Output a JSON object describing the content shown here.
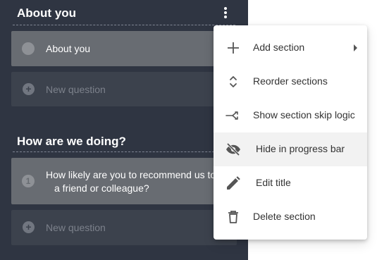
{
  "sections": [
    {
      "title": "About you",
      "items": [
        {
          "label": "About you",
          "number": ""
        }
      ],
      "new_question_label": "New question"
    },
    {
      "title": "How are we doing?",
      "items": [
        {
          "label_line1": "How likely are you to recommend us to",
          "label_line2": "a friend or colleague?",
          "number": "1"
        }
      ],
      "new_question_label": "New question"
    }
  ],
  "menu": {
    "items": [
      {
        "label": "Add section",
        "icon": "plus-icon",
        "has_submenu": true
      },
      {
        "label": "Reorder sections",
        "icon": "reorder-icon"
      },
      {
        "label": "Show section skip logic",
        "icon": "skip-logic-icon"
      },
      {
        "label": "Hide in progress bar",
        "icon": "eye-off-icon",
        "highlighted": true
      },
      {
        "label": "Edit title",
        "icon": "pencil-icon"
      },
      {
        "label": "Delete section",
        "icon": "trash-icon"
      }
    ]
  },
  "colors": {
    "panel": "#2f3542",
    "card": "#686c72",
    "new_card": "#3c424d",
    "menu_text": "#333333",
    "menu_icon": "#555555"
  }
}
